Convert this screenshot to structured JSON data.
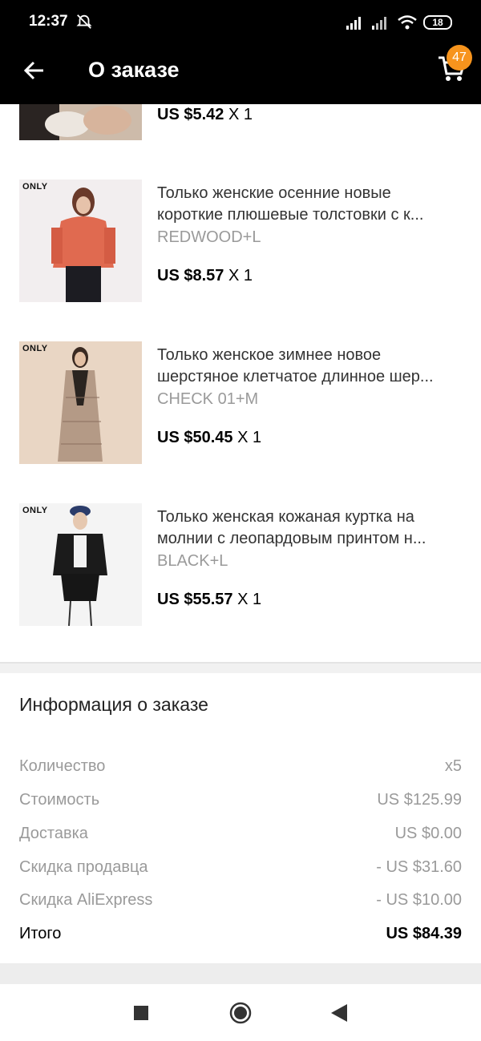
{
  "status_bar": {
    "time": "12:37",
    "battery": "18"
  },
  "toolbar": {
    "title": "О заказе",
    "cart_count": "47"
  },
  "items": [
    {
      "title_line1": "",
      "title_line2": "",
      "variant": "",
      "price": "US $5.42",
      "qty": "X 1"
    },
    {
      "brand": "ONLY",
      "title_line1": "Только женские осенние новые",
      "title_line2": "короткие плюшевые толстовки с к...",
      "variant": "REDWOOD+L",
      "price": "US $8.57",
      "qty": "X 1"
    },
    {
      "brand": "ONLY",
      "title_line1": "Только женское зимнее новое",
      "title_line2": "шерстяное клетчатое длинное шер...",
      "variant": "CHECK 01+M",
      "price": "US $50.45",
      "qty": "X 1"
    },
    {
      "brand": "ONLY",
      "title_line1": "Только женская кожаная куртка на",
      "title_line2": "молнии с леопардовым принтом н...",
      "variant": "BLACK+L",
      "price": "US $55.57",
      "qty": "X 1"
    }
  ],
  "order_info": {
    "title": "Информация о заказе",
    "rows": [
      {
        "label": "Количество",
        "value": "x5"
      },
      {
        "label": "Стоимость",
        "value": "US $125.99"
      },
      {
        "label": "Доставка",
        "value": "US $0.00"
      },
      {
        "label": "Скидка продавца",
        "value": "- US $31.60"
      },
      {
        "label": "Скидка AliExpress",
        "value": "- US $10.00"
      },
      {
        "label": "Итого",
        "value": "US $84.39"
      }
    ]
  },
  "colors": {
    "accent": "#f7941d",
    "header": "#000000",
    "muted_text": "#9a9a9a"
  },
  "icons": [
    "back-arrow-icon",
    "cart-icon",
    "alarm-off-icon",
    "signal-icon",
    "wifi-icon",
    "battery-icon",
    "nav-recents-icon",
    "nav-home-icon",
    "nav-back-icon"
  ]
}
